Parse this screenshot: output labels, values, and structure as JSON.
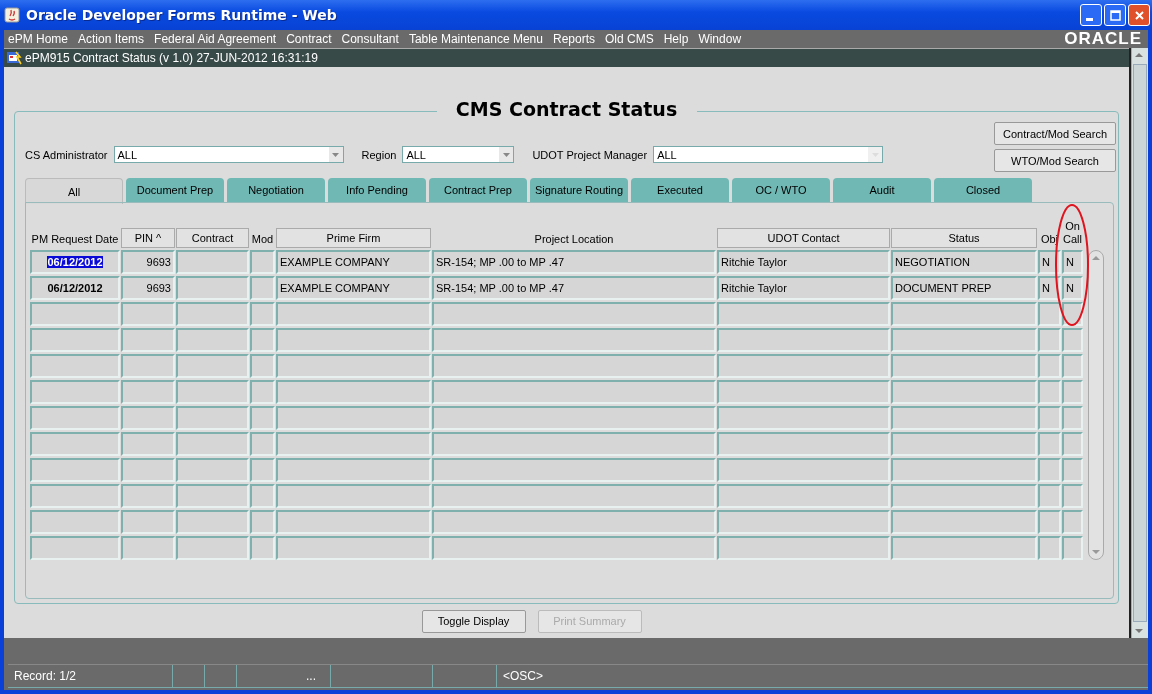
{
  "window": {
    "title": "Oracle Developer Forms Runtime - Web"
  },
  "menu": [
    "ePM Home",
    "Action Items",
    "Federal Aid Agreement",
    "Contract",
    "Consultant",
    "Table Maintenance Menu",
    "Reports",
    "Old CMS",
    "Help",
    "Window"
  ],
  "logo": "ORACLE",
  "form_window": {
    "title": "ePM915 Contract Status (v 1.0)  27-JUN-2012 16:31:19"
  },
  "form": {
    "heading": "CMS Contract Status",
    "filters": [
      {
        "label": "CS Administrator",
        "value": "ALL",
        "disabled": false
      },
      {
        "label": "Region",
        "value": "ALL",
        "disabled": false
      },
      {
        "label": "UDOT Project Manager",
        "value": "ALL",
        "disabled": true
      }
    ],
    "search_buttons": [
      "Contract/Mod Search",
      "WTO/Mod Search"
    ],
    "tabs": [
      {
        "label": "All",
        "selected": true
      },
      {
        "label": "Document Prep",
        "selected": false
      },
      {
        "label": "Negotiation",
        "selected": false
      },
      {
        "label": "Info Pending",
        "selected": false
      },
      {
        "label": "Contract Prep",
        "selected": false
      },
      {
        "label": "Signature Routing",
        "selected": false
      },
      {
        "label": "Executed",
        "selected": false
      },
      {
        "label": "OC / WTO",
        "selected": false
      },
      {
        "label": "Audit",
        "selected": false
      },
      {
        "label": "Closed",
        "selected": false
      }
    ],
    "table": {
      "columns": [
        {
          "label": "PM Request Date",
          "kind": "label",
          "circled": false
        },
        {
          "label": "PIN ^",
          "kind": "button",
          "circled": false
        },
        {
          "label": "Contract",
          "kind": "button",
          "circled": false
        },
        {
          "label": "Mod",
          "kind": "label",
          "circled": false
        },
        {
          "label": "Prime Firm",
          "kind": "button",
          "circled": false
        },
        {
          "label": "Project Location",
          "kind": "label",
          "circled": false
        },
        {
          "label": "UDOT Contact",
          "kind": "button",
          "circled": false
        },
        {
          "label": "Status",
          "kind": "button",
          "circled": false
        },
        {
          "label": "Obj",
          "kind": "label",
          "circled": false
        },
        {
          "label": "On Call",
          "kind": "label",
          "circled": true
        }
      ],
      "rows": [
        {
          "current": true,
          "cells": [
            "06/12/2012",
            "9693",
            "",
            "",
            "EXAMPLE COMPANY",
            "SR-154; MP .00 to MP .47",
            "Ritchie Taylor",
            "NEGOTIATION",
            "N",
            "N"
          ]
        },
        {
          "current": false,
          "cells": [
            "06/12/2012",
            "9693",
            "",
            "",
            "EXAMPLE COMPANY",
            "SR-154; MP .00 to MP .47",
            "Ritchie Taylor",
            "DOCUMENT PREP",
            "N",
            "N"
          ]
        },
        {},
        {},
        {},
        {},
        {},
        {},
        {},
        {},
        {},
        {}
      ]
    },
    "bottom_buttons": [
      {
        "label": "Toggle Display",
        "disabled": false
      },
      {
        "label": "Print Summary",
        "disabled": true
      }
    ]
  },
  "status_bar": {
    "segments": [
      "Record: 1/2",
      "...",
      "<OSC>"
    ]
  }
}
